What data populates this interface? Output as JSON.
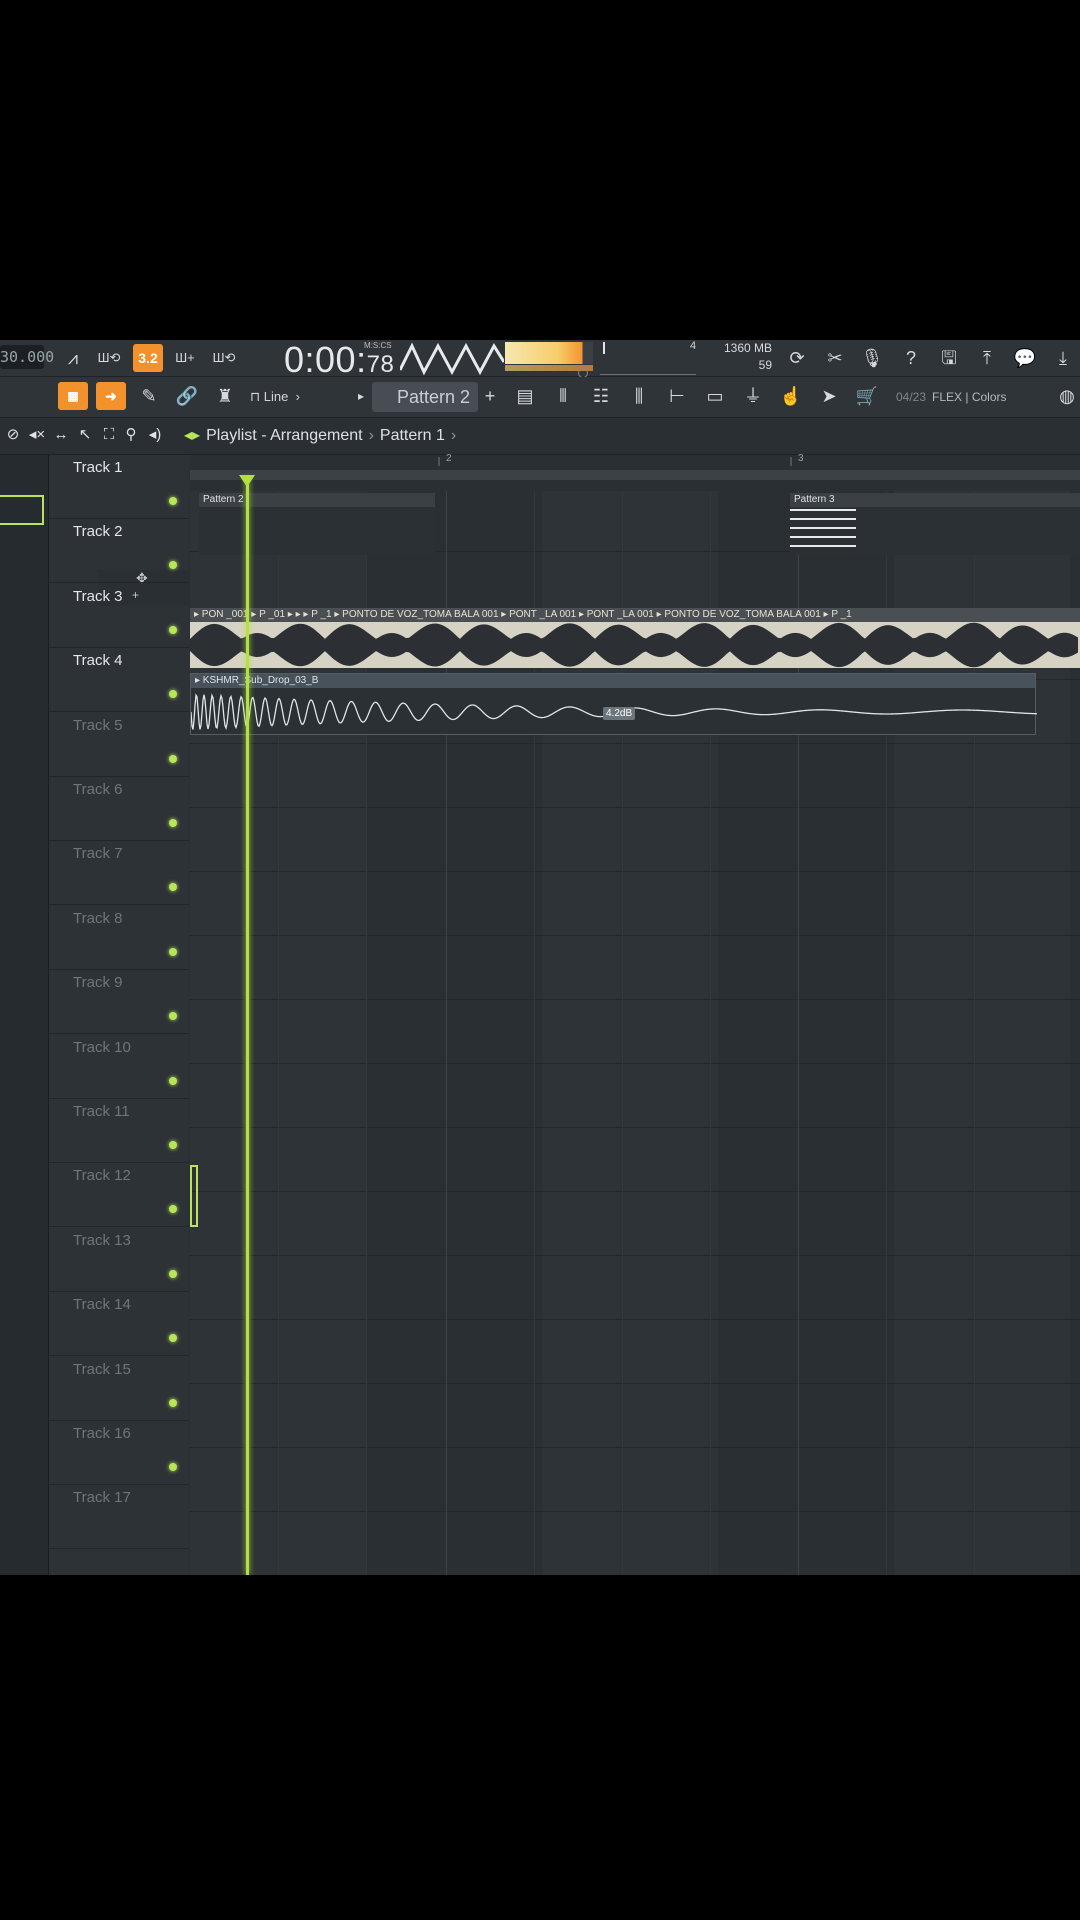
{
  "toolbar": {
    "tempo": "30.000",
    "pattern_song_toggle": "3.2",
    "time_main": "0:00",
    "time_frac": "78",
    "time_label": "M:S:CS",
    "cpu_value": "4",
    "memory": "1360 MB",
    "polyphony": "59",
    "snap_label": "Line",
    "pattern_selected": "Pattern 2",
    "hint_counter": "04/23",
    "hint_text": "FLEX | Colors"
  },
  "playlist": {
    "window_title": "Playlist - Arrangement",
    "current_pattern": "Pattern 1",
    "ruler": [
      "2",
      "3"
    ],
    "clips": {
      "pattern_a": "Pattern 2",
      "pattern_b": "Pattern 3",
      "audio_track3": "▸ PON _001 ▸ P _01 ▸ ▸ ▸ P _1 ▸ PONTO DE VOZ_TOMA BALA 001 ▸ PONT _LA 001 ▸ PONT _LA 001 ▸ PONTO DE VOZ_TOMA BALA 001 ▸ P _1",
      "audio_track4": "▸ KSHMR_Sub_Drop_03_B",
      "gain_label": "4.2dB"
    },
    "tracks": [
      "Track 1",
      "Track 2",
      "Track 3",
      "Track 4",
      "Track 5",
      "Track 6",
      "Track 7",
      "Track 8",
      "Track 9",
      "Track 10",
      "Track 11",
      "Track 12",
      "Track 13",
      "Track 14",
      "Track 15",
      "Track 16",
      "Track 17"
    ]
  },
  "colors": {
    "accent_green": "#b4e142",
    "accent_orange": "#f3922d"
  }
}
